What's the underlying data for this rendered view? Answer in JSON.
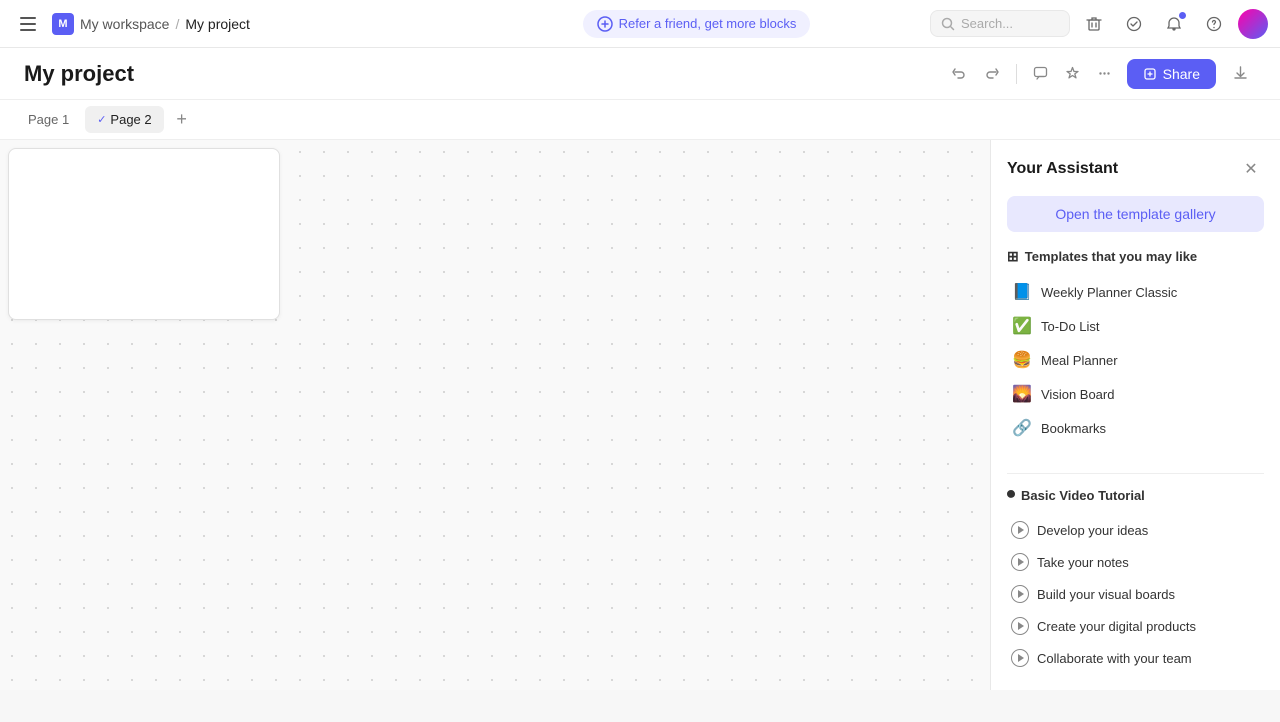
{
  "topnav": {
    "menu_label": "☰",
    "workspace_initial": "M",
    "workspace_name": "My workspace",
    "breadcrumb_sep": "/",
    "project_name": "My project",
    "refer_label": "Refer a friend, get more blocks",
    "search_placeholder": "Search...",
    "share_label": "Share"
  },
  "page": {
    "title": "My project",
    "undo_label": "↩",
    "redo_label": "↪",
    "comment_label": "💬",
    "star_label": "☆",
    "more_label": "···"
  },
  "tabs": [
    {
      "label": "Page 1",
      "active": false
    },
    {
      "label": "Page 2",
      "active": true
    }
  ],
  "assistant": {
    "title": "Your Assistant",
    "open_gallery_label": "Open the template gallery",
    "templates_section": "Templates that you may like",
    "templates": [
      {
        "emoji": "📘",
        "label": "Weekly Planner Classic"
      },
      {
        "emoji": "✅",
        "label": "To-Do List"
      },
      {
        "emoji": "🍔",
        "label": "Meal Planner"
      },
      {
        "emoji": "🌄",
        "label": "Vision Board"
      },
      {
        "emoji": "🔗",
        "label": "Bookmarks"
      }
    ],
    "tutorial_section": "Basic Video Tutorial",
    "tutorials": [
      {
        "label": "Develop your ideas"
      },
      {
        "label": "Take your notes"
      },
      {
        "label": "Build your visual boards"
      },
      {
        "label": "Create your digital products"
      },
      {
        "label": "Collaborate with your team"
      }
    ]
  }
}
